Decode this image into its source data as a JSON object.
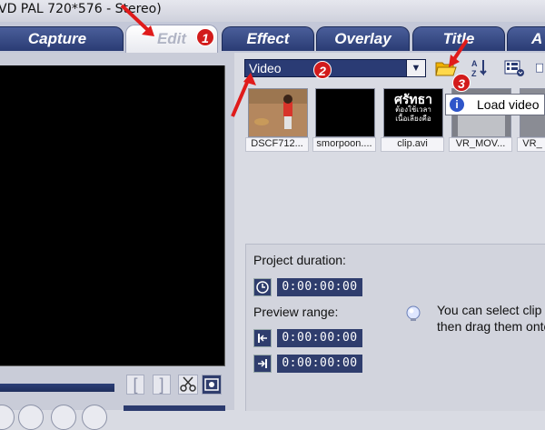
{
  "window": {
    "title": "VD PAL 720*576 - Stereo)"
  },
  "tabs": [
    {
      "label": "Capture",
      "active": false
    },
    {
      "label": "Edit",
      "active": true
    },
    {
      "label": "Effect",
      "active": false
    },
    {
      "label": "Overlay",
      "active": false
    },
    {
      "label": "Title",
      "active": false
    },
    {
      "label": "A",
      "active": false
    }
  ],
  "library": {
    "dropdown_value": "Video",
    "tooltip": "Load video",
    "clips": [
      {
        "label": "DSCF712..."
      },
      {
        "label": "smorpoon...."
      },
      {
        "label": "clip.avi",
        "thumb_text_lines": [
          "ศรัทธา",
          "ต้องใช้เวลา",
          "เนื้อเลียงคือ"
        ]
      },
      {
        "label": "VR_MOV..."
      },
      {
        "label": "VR_"
      }
    ]
  },
  "preview_controls": {
    "mark_in": "[",
    "mark_out": "]"
  },
  "project": {
    "duration_label": "Project duration:",
    "duration_value": "0:00:00:00",
    "preview_range_label": "Preview range:",
    "range_start": "0:00:00:00",
    "range_end": "0:00:00:00",
    "hint_lines": [
      "You can select clip",
      "then drag them onto"
    ]
  },
  "annotations": {
    "step1": "1",
    "step2": "2",
    "step3": "3"
  },
  "colors": {
    "tab_blue": "#2a3c74",
    "timebox_blue": "#2f3d6d",
    "badge_red": "#d21b1b"
  }
}
